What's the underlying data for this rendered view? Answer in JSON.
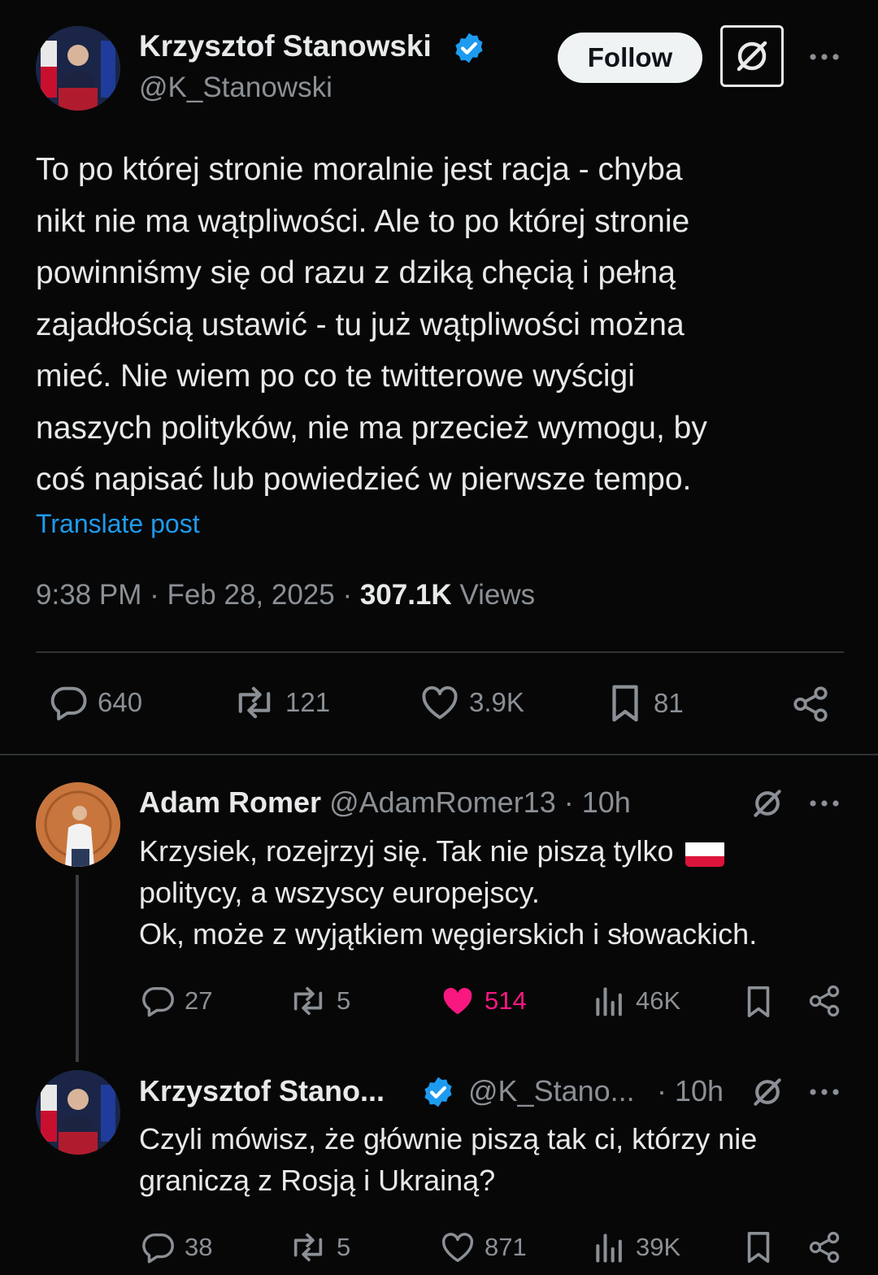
{
  "main_post": {
    "author_name": "Krzysztof Stanowski",
    "handle": "@K_Stanowski",
    "follow_label": "Follow",
    "text_lines": [
      "To po której stronie moralnie jest racja - chyba",
      "nikt nie ma wątpliwości. Ale to po której stronie",
      "powinniśmy się od razu z dziką chęcią i pełną",
      "zajadłością ustawić - tu już wątpliwości można",
      "mieć. Nie wiem po co te twitterowe wyścigi",
      "naszych polityków, nie ma przecież wymogu, by",
      "coś napisać lub powiedzieć w pierwsze tempo."
    ],
    "translate_label": "Translate post",
    "timestamp": "9:38 PM · Feb 28, 2025 · ",
    "views_count": "307.1K",
    "views_label": " Views",
    "stats": {
      "replies": "640",
      "reposts": "121",
      "likes": "3.9K",
      "bookmarks": "81"
    }
  },
  "reply1": {
    "author_name": "Adam Romer",
    "handle_time": "@AdamRomer13 · 10h",
    "text_line1": "Krzysiek, rozejrzyj się. Tak nie piszą tylko ",
    "flag_emoji": "🇵🇱",
    "text_line2": "politycy, a wszyscy europejscy.",
    "text_line3": "Ok, może z wyjątkiem węgierskich i słowackich.",
    "stats": {
      "replies": "27",
      "reposts": "5",
      "likes": "514",
      "views": "46K"
    }
  },
  "reply2": {
    "author_name": "Krzysztof Stano...",
    "handle": "@K_Stano...",
    "time": "· 10h",
    "text_line1": "Czyli mówisz, że głównie piszą tak ci, którzy nie",
    "text_line2": "graniczą z Rosją i Ukrainą?",
    "stats": {
      "replies": "38",
      "reposts": "5",
      "likes": "871",
      "views": "39K"
    }
  },
  "colors": {
    "background": "#070707",
    "text": "#e7e9ea",
    "muted": "#8b9096",
    "link": "#1d9bf0",
    "verified": "#1d9bf0",
    "like_active": "#f91880",
    "divider": "#2f3336"
  },
  "icons": [
    "verified-badge-icon",
    "grok-icon",
    "more-icon",
    "reply-icon",
    "repost-icon",
    "like-icon",
    "bookmark-icon",
    "share-icon",
    "views-icon"
  ]
}
